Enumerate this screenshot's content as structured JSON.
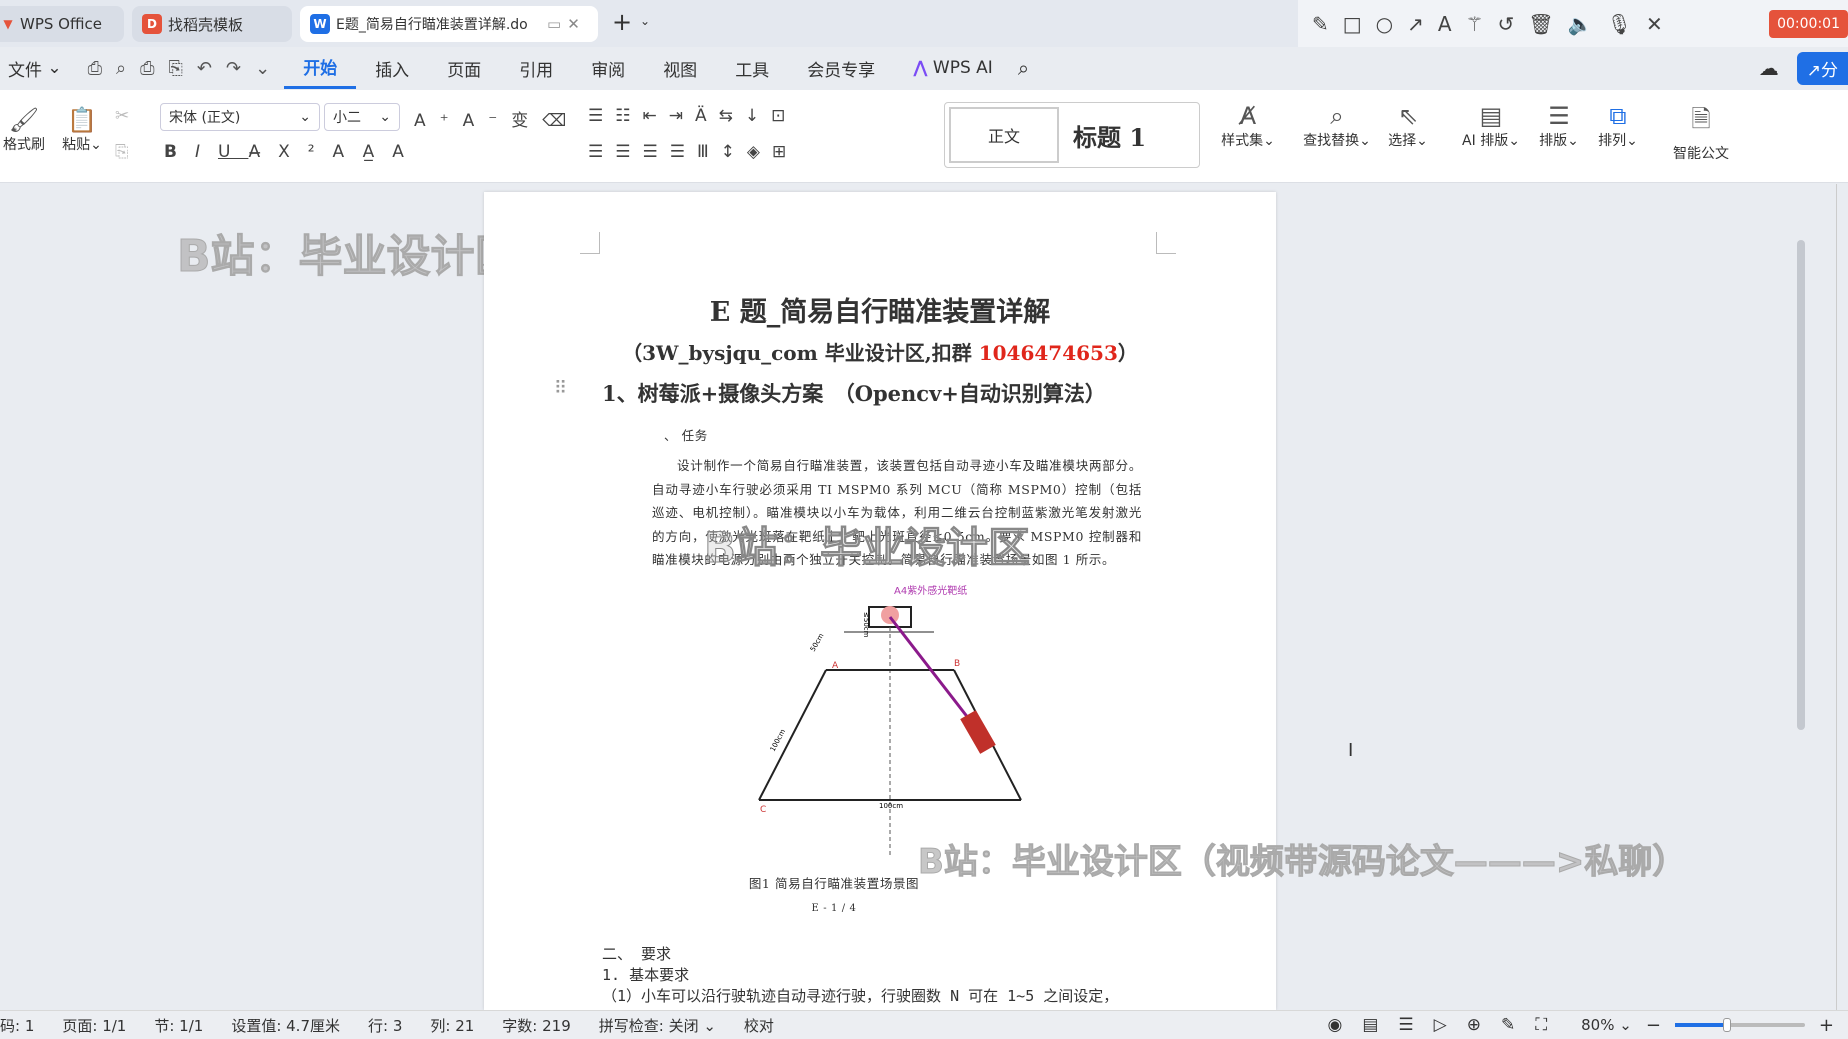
{
  "tabs": [
    {
      "label": "WPS Office"
    },
    {
      "label": "找稻壳模板"
    },
    {
      "label": "E题_简易自行瞄准装置详解.do"
    }
  ],
  "recorder": {
    "timer": "00:00:01"
  },
  "menu": [
    "文件",
    "开始",
    "插入",
    "页面",
    "引用",
    "审阅",
    "视图",
    "工具",
    "会员专享",
    "WPS AI"
  ],
  "share_label": "分",
  "ribbon": {
    "format_painter": "格式刷",
    "paste": "粘贴",
    "font": "宋体 (正文)",
    "size": "小二",
    "style_normal": "正文",
    "style_heading": "标题 1",
    "style_set": "样式集",
    "find_replace": "查找替换",
    "select": "选择",
    "ai_layout": "AI 排版",
    "layout": "排版",
    "arrange": "排列",
    "smart_doc": "智能公文"
  },
  "doc": {
    "title": "E 题_简易自行瞄准装置详解",
    "subtitle_pre": "（3W_bysjqu_com 毕业设计区,扣群 ",
    "subtitle_num": "1046474653",
    "subtitle_post": "）",
    "heading1": "1、树莓派+摄像头方案　（Opencv+自动识别算法）",
    "task": "、 任务",
    "para": "设计制作一个简易自行瞄准装置，该装置包括自动寻迹小车及瞄准模块两部分。自动寻迹小车行驶必须采用 TI MSPM0 系列 MCU（简称 MSPM0）控制（包括巡迹、电机控制）。瞄准模块以小车为载体，利用二维云台控制蓝紫激光笔发射激光的方向，使激光光斑落在靶纸上，靶上光斑直径≤0.5cm。要求 MSPM0 控制器和瞄准模块的电源分别由两个独立开关控制。简易自行瞄准装置场景如图 1 所示。",
    "fig_label_top": "A4紫外感光靶纸",
    "fig_dims": [
      "≤50cm",
      "50cm",
      "100cm",
      "100cm"
    ],
    "fig_points": [
      "A",
      "B",
      "C"
    ],
    "fig_caption": "图1  简易自行瞄准装置场景图",
    "fig_page": "E - 1 / 4",
    "req_title": "二、 要求",
    "req_basic": "1. 基本要求",
    "req_1": "（1）小车可以沿行驶轨迹自动寻迹行驶，行驶圈数 N 可在 1~5 之间设定，"
  },
  "watermarks": [
    "B站：毕业设计区",
    "B站：毕业设计区",
    "B站：毕业设计区（视频带源码论文———>私聊）"
  ],
  "status": {
    "page_code": "码: 1",
    "page": "页面: 1/1",
    "section": "节: 1/1",
    "setting": "设置值: 4.7厘米",
    "row": "行: 3",
    "col": "列: 21",
    "words": "字数: 219",
    "spell": "拼写检查: 关闭",
    "proof": "校对",
    "zoom": "80%",
    "zoom_fraction": 0.4
  },
  "colors": {
    "accent": "#1f6fe5",
    "red": "#e0261b",
    "timer": "#e5533b"
  }
}
